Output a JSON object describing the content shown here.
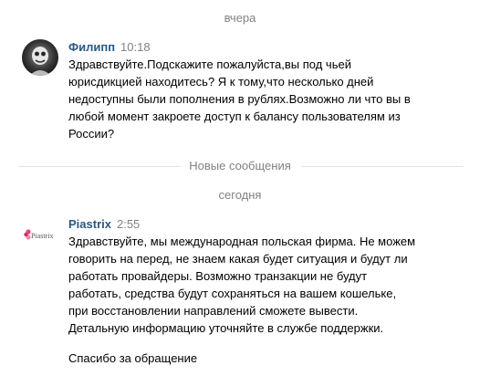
{
  "dates": {
    "yesterday": "вчера",
    "new_messages": "Новые сообщения",
    "today": "сегодня"
  },
  "messages": [
    {
      "author": "Филипп",
      "time": "10:18",
      "avatar_icon": "user-avatar-photo",
      "text": "Здравствуйте.Подскажите пожалуйста,вы под чьей\nюрисдикцией находитесь? Я к тому,что несколько дней\nнедоступны были пополнения в рублях.Возможно ли что вы в\nлюбой момент закроете доступ к балансу пользователям из\nРоссии?"
    },
    {
      "author": "Piastrix",
      "time": "2:55",
      "avatar_icon": "piastrix-logo",
      "avatar_logo_text": "Piastrix",
      "text": "Здравствуйте, мы международная польская фирма. Не можем\nговорить на перед, не знаем какая будет ситуация и будут ли\nработать провайдеры. Возможно транзакции не будут\nработать, средства будут сохраняться на вашем кошельке,\nпри восстановлении направлений сможете вывести.\nДетальную информацию уточняйте в службе поддержки.",
      "text2": "Спасибо за обращение"
    }
  ],
  "colors": {
    "author": "#2a5885",
    "meta": "#828282",
    "separator": "#e1e3e6",
    "logo_pink": "#e8457a"
  }
}
